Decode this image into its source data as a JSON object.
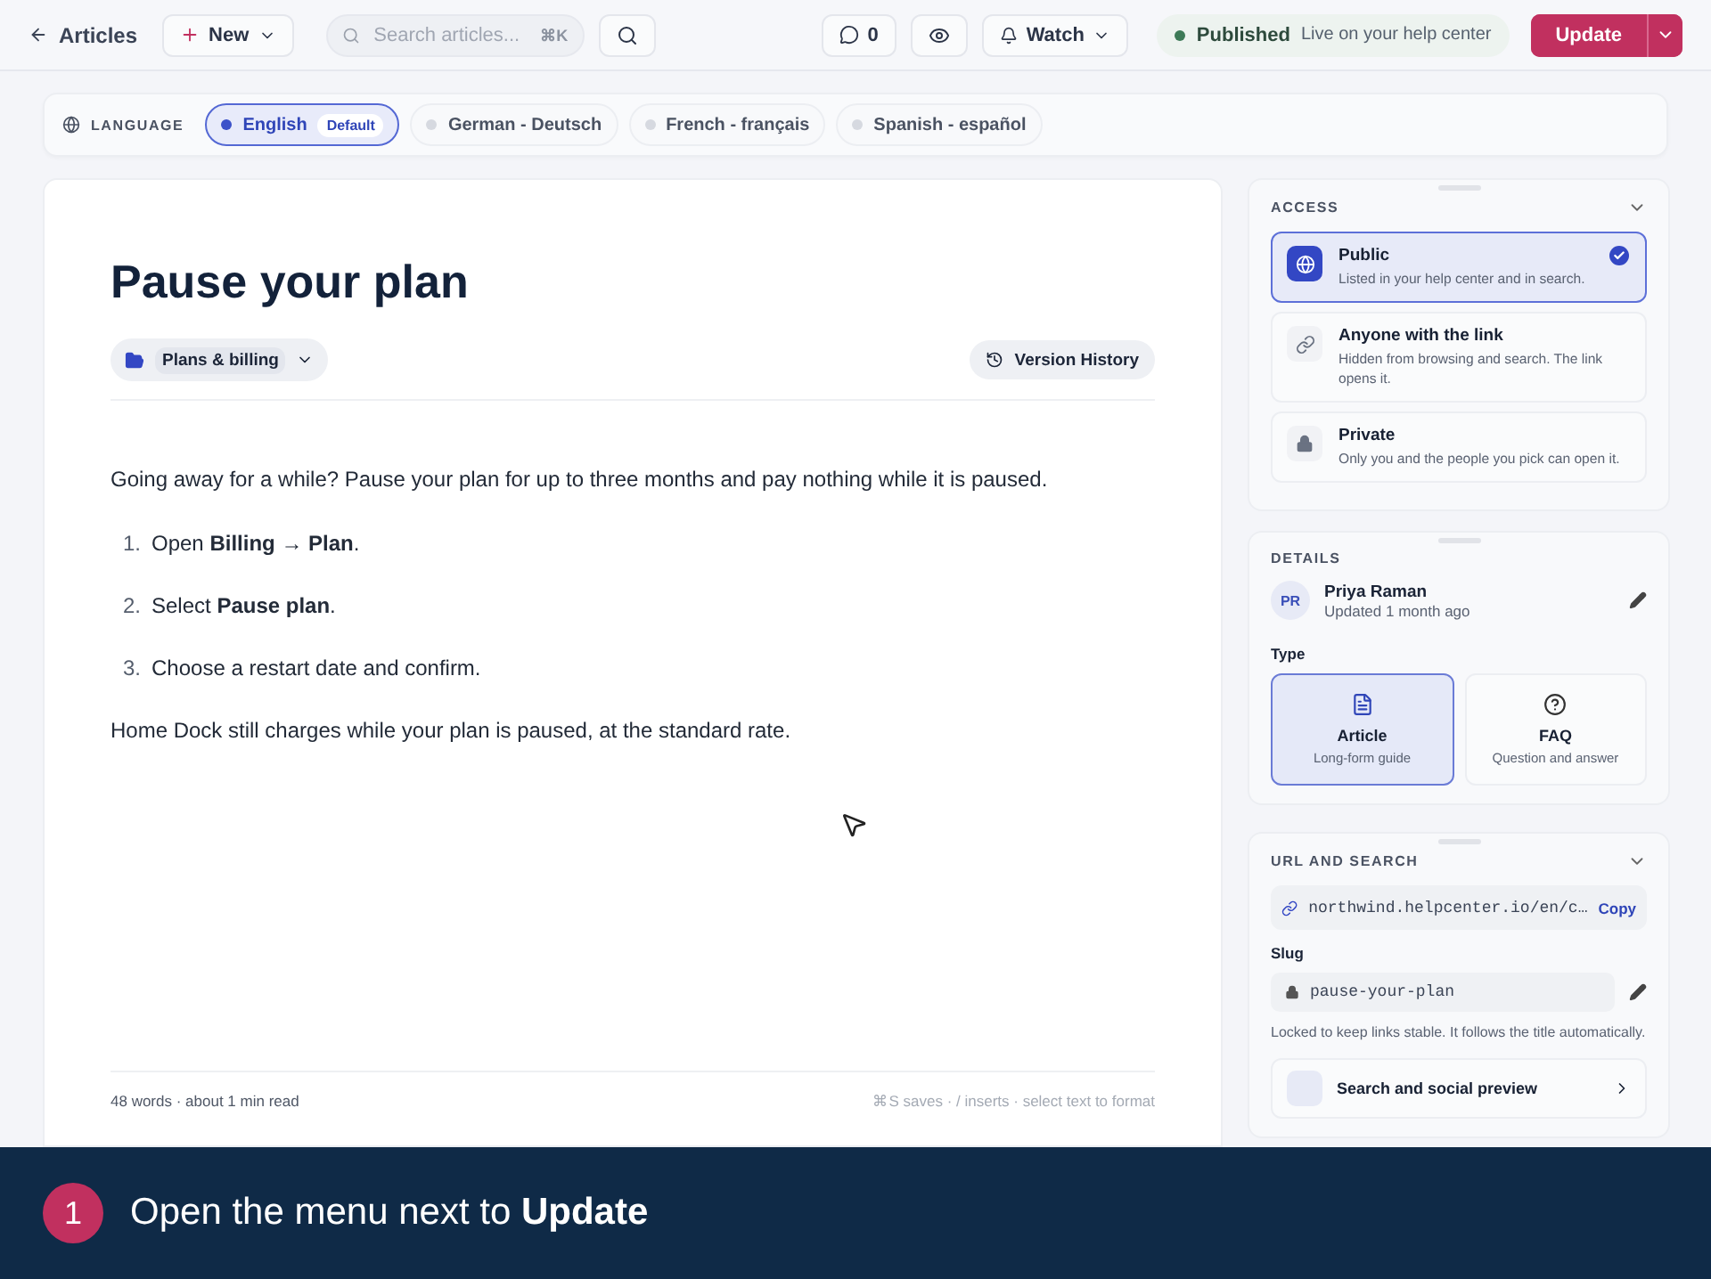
{
  "topbar": {
    "back": "Articles",
    "new": "New",
    "search": {
      "placeholder": "Search articles..."
    },
    "shortcut": "⌘K",
    "comments": "0",
    "watch": "Watch",
    "status": {
      "label": "Published",
      "detail": "Live on your help center"
    },
    "primary": "Update"
  },
  "language": {
    "label": "LANGUAGE",
    "items": [
      {
        "name": "English",
        "badge": "Default",
        "selected": true
      },
      {
        "name": "German - Deutsch",
        "selected": false
      },
      {
        "name": "French - français",
        "selected": false
      },
      {
        "name": "Spanish - español",
        "selected": false
      }
    ]
  },
  "article": {
    "title": "Pause your plan",
    "category": "Plans & billing",
    "version": "Version History",
    "intro": "Going away for a while? Pause your plan for up to three months and pay nothing while it is paused.",
    "steps": [
      {
        "number": "1.",
        "text": "Open **Billing → Plan**."
      },
      {
        "number": "2.",
        "text": "Select **Pause plan**."
      },
      {
        "number": "3.",
        "text": "Choose a restart date and confirm."
      }
    ],
    "outro": "Home Dock still charges while your plan is paused, at the standard rate.",
    "word_count": "48 words · about 1 min read",
    "hints": "⌘S saves · / inserts · select text to format"
  },
  "access": {
    "title": "ACCESS",
    "options": [
      {
        "kind": "globe",
        "title": "Public",
        "description": "Listed in your help center and in search.",
        "selected": true
      },
      {
        "kind": "link",
        "title": "Anyone with the link",
        "description": "Hidden from browsing and search. The link opens it.",
        "selected": false
      },
      {
        "kind": "lock",
        "title": "Private",
        "description": "Only you and the people you pick can open it.",
        "selected": false
      }
    ]
  },
  "details": {
    "title": "DETAILS",
    "author": {
      "initials": "PR",
      "name": "Priya Raman",
      "updated": "Updated 1 month ago"
    },
    "type_label": "Type",
    "types": [
      {
        "kind": "article",
        "title": "Article",
        "description": "Long-form guide",
        "selected": true
      },
      {
        "kind": "faq",
        "title": "FAQ",
        "description": "Question and answer",
        "selected": false
      }
    ]
  },
  "url": {
    "title": "URL AND SEARCH",
    "url": "northwind.helpcenter.io/en/c…",
    "copy": "Copy",
    "slug_label": "Slug",
    "slug": "pause-your-plan",
    "note": "Locked to keep links stable. It follows the title automatically.",
    "preview": "Search and social preview"
  },
  "banner": {
    "step": "1",
    "text": "Open the menu next to **Update**"
  }
}
